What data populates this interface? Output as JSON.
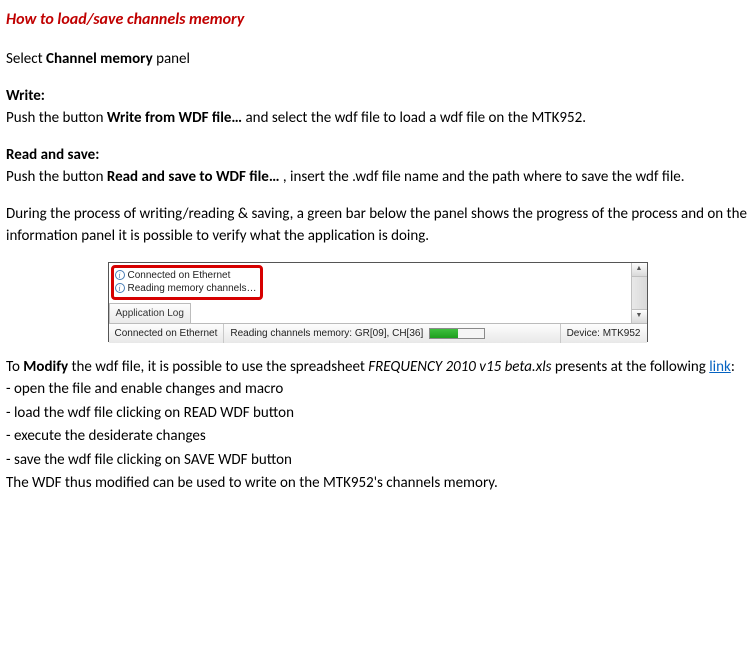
{
  "title": "How to load/save channels memory",
  "select_pre": "Select ",
  "select_bold": "Channel memory",
  "select_post": " panel",
  "write_heading": "Write:",
  "write_pre": "Push the button ",
  "write_bold": "Write from WDF file…",
  "write_post": " and select  the wdf file to load a wdf file on the MTK952.",
  "read_heading": "Read and save:",
  "read_pre": "Push the button ",
  "read_bold": "Read and save to WDF file…",
  "read_post": " , insert the .wdf file name and the path where to save the wdf file.",
  "process_text": "During the process of writing/reading & saving, a green bar below the panel shows the progress of the process and on the information panel it is possible to verify what the application is doing.",
  "screenshot": {
    "info_line1": "Connected on Ethernet",
    "info_line2": "Reading memory channels…",
    "applog_tab": "Application Log",
    "status_connected": "Connected on Ethernet",
    "status_reading": "Reading channels memory: GR[09], CH[36]",
    "status_device": "Device: MTK952",
    "info_glyph": "i"
  },
  "modify_pre1": "To ",
  "modify_bold": "Modify",
  "modify_mid": " the wdf file, it is possible to use the spreadsheet ",
  "modify_italic": "FREQUENCY 2010 v15 beta.xls",
  "modify_post1": " presents at the following ",
  "modify_link": "link",
  "modify_colon": ":",
  "step1": "- open the file and enable changes  and macro",
  "step2": "- load the wdf file clicking on READ WDF button",
  "step3": "- execute the desiderate changes",
  "step4": "- save the wdf file clicking on SAVE WDF button",
  "final": "The WDF thus modified can be used to write on the MTK952's channels memory."
}
